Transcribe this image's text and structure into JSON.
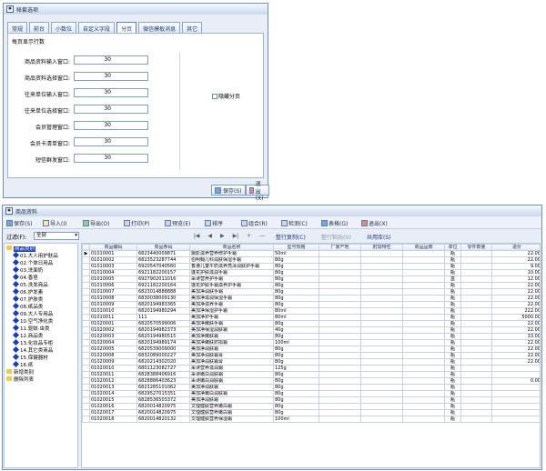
{
  "dialog": {
    "title": "帐套选项",
    "tabs": [
      "常规",
      "前台",
      "小数位",
      "自定义字段",
      "分页",
      "微信模板消息",
      "其它"
    ],
    "active_tab": "分页",
    "group_title": "每页显示行数",
    "fields": [
      {
        "label": "商品资料输入窗口:",
        "value": "30"
      },
      {
        "label": "商品资料选择窗口:",
        "value": "30"
      },
      {
        "label": "往来单位输入窗口:",
        "value": "30"
      },
      {
        "label": "往来单位选择窗口:",
        "value": "30"
      },
      {
        "label": "会员管理窗口:",
        "value": "30"
      },
      {
        "label": "会员卡清单窗口:",
        "value": "30"
      },
      {
        "label": "短信群发窗口:",
        "value": "30"
      }
    ],
    "checkbox_label": "隐藏分页",
    "save_label": "保存(S)",
    "exit_label": "退出(X)"
  },
  "main": {
    "title": "商品资料",
    "toolbar": [
      "保存(S)",
      "导入(I)",
      "导出(O)",
      "打印(P)",
      "预览(E)",
      "排序",
      "组合(R)",
      "检测(C)",
      "表格(G)",
      "退出(X)"
    ],
    "filter_label": "过滤(F):",
    "filter_value": "全部",
    "nav": [
      "ǀ◀",
      "◀",
      "▶",
      "▶ǀ",
      "+",
      "—"
    ],
    "links": [
      "整行复制(C)",
      "整行粘贴(V)",
      "共用库(S)"
    ],
    "tree_root": "商品类别",
    "tree_items": [
      "01.大人用护肤品",
      "02.个体日用品",
      "03.洗面奶",
      "04.香皂",
      "05.洗发商品",
      "06.护发素",
      "07.护肤类",
      "08.纸品类",
      "09.大人专用品",
      "10.空气净化类",
      "11.驱蚊·虫类",
      "12.商品类",
      "13.化妆品专柜",
      "14.其它类商品",
      "15.保健器材",
      "16.纸"
    ],
    "tree_extra": [
      "新增类别",
      "删除列表"
    ],
    "columns": [
      "商品编码",
      "商品条码",
      "商品名称",
      "型号规格",
      "厂家产地",
      "附加特性",
      "商品品牌",
      "单位",
      "零件数量",
      "进价"
    ],
    "rows": [
      [
        "01010001",
        "6823440009871",
        "飘影滋养营养修护手霜",
        "50ml",
        "",
        "",
        "",
        "瓶",
        "",
        "22.00"
      ],
      [
        "01010002",
        "6823523287744",
        "伯明翰儿科润肤保湿手霜",
        "80g",
        "",
        "",
        "",
        "瓶",
        "",
        "22.00"
      ],
      [
        "01010003",
        "6920547040560",
        "香港儿童牛奶滋养亮泽润肤护手霜",
        "80g",
        "",
        "",
        "",
        "瓶",
        "",
        "9.00"
      ],
      [
        "01010004",
        "6921182200157",
        "莲花护肤滋润手霜",
        "80g",
        "",
        "",
        "",
        "瓶",
        "",
        "10.00"
      ],
      [
        "01010005",
        "6927902011016",
        "采诗营养护手霜",
        "80g",
        "",
        "",
        "",
        "盒",
        "",
        "12.00"
      ],
      [
        "01010006",
        "6921182200164",
        "莲花护肤手霜滋养护手霜",
        "80g",
        "",
        "",
        "",
        "瓶",
        "",
        "22.00"
      ],
      [
        "01010007",
        "6823014888888",
        "美加净润肤手霜",
        "80g",
        "",
        "",
        "",
        "瓶",
        "",
        "22.00"
      ],
      [
        "01010008",
        "6830038009130",
        "美加净滋润保湿手霜",
        "80g",
        "",
        "",
        "",
        "瓶",
        "",
        "22.00"
      ],
      [
        "01010009",
        "6820194983365",
        "美加净滋养手霜",
        "80g",
        "",
        "",
        "",
        "瓶",
        "",
        "22.00"
      ],
      [
        "01010010",
        "6820194980294",
        "美加净保湿护手霜",
        "80ml",
        "",
        "",
        "",
        "瓶",
        "",
        "222.00"
      ],
      [
        "01010011",
        "111",
        "美加净护手霜",
        "80ml",
        "",
        "",
        "",
        "瓶",
        "",
        "5000.00"
      ],
      [
        "01020001",
        "6820570599006",
        "美加净嫩肤手霜",
        "80g",
        "",
        "",
        "",
        "瓶",
        "",
        "22.00"
      ],
      [
        "01020002",
        "6820194982373",
        "美加净保湿润肤霜",
        "40g",
        "",
        "",
        "",
        "瓶",
        "",
        "22.00"
      ],
      [
        "01020003",
        "6820194980515",
        "美加净嫩肤霜",
        "80g",
        "",
        "",
        "",
        "瓶",
        "",
        "33.00"
      ],
      [
        "01020004",
        "6820194989174",
        "美加净嫩肤防损霜",
        "100ml",
        "",
        "",
        "",
        "瓶",
        "",
        "22.00"
      ],
      [
        "01020005",
        "6820539009000",
        "美加净润肤霜",
        "80g",
        "",
        "",
        "",
        "瓶",
        "",
        "22.00"
      ],
      [
        "01020008",
        "6832089000227",
        "美加净润肤霜膏",
        "80g",
        "",
        "",
        "",
        "瓶",
        "",
        "22.00"
      ],
      [
        "01020009",
        "6820214302020",
        "美加净润肤霜膏",
        "80g",
        "",
        "",
        "",
        "瓶",
        "",
        "22.00"
      ],
      [
        "01020010",
        "6801123082727",
        "采诗营养滋润霜",
        "125g",
        "",
        "",
        "",
        "瓶",
        "",
        ""
      ],
      [
        "01020011",
        "6828388406916",
        "采诗嫩白润肤霜",
        "80g",
        "",
        "",
        "",
        "瓶",
        "",
        ""
      ],
      [
        "01020012",
        "6828886403623",
        "采诗嫩白润肤霜",
        "80g",
        "",
        "",
        "",
        "瓶",
        "",
        "0.00"
      ],
      [
        "01020013",
        "6823285101062",
        "美加净润肤霜",
        "80g",
        "",
        "",
        "",
        "瓶",
        "",
        ""
      ],
      [
        "01020014",
        "6829527015351",
        "美加净嫩白润肤霜",
        "80g",
        "",
        "",
        "",
        "瓶",
        "",
        ""
      ],
      [
        "01020015",
        "6828536503372",
        "美加净润肤霜",
        "80g",
        "",
        "",
        "",
        "瓶",
        "",
        ""
      ],
      [
        "01020016",
        "6820014820975",
        "文理健肤营养嫩白霜",
        "80g",
        "",
        "",
        "",
        "瓶",
        "",
        ""
      ],
      [
        "01020017",
        "6820014820975",
        "文理健肤营养嫩白霜",
        "80g",
        "",
        "",
        "",
        "瓶",
        "",
        ""
      ],
      [
        "01020018",
        "6820014820132",
        "文理健肤营养保湿霜",
        "100ml",
        "",
        "",
        "",
        "瓶",
        "",
        ""
      ]
    ]
  }
}
